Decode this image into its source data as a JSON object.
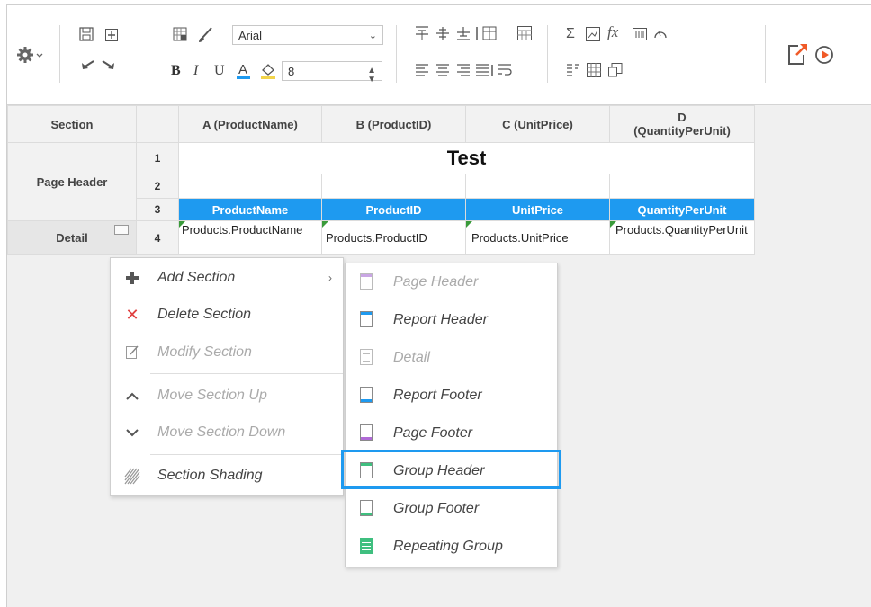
{
  "toolbar": {
    "font_name": "Arial",
    "font_size": "8",
    "bold": "B",
    "italic": "I",
    "underline": "U",
    "font_color": "A",
    "sigma": "Σ",
    "fx": "fx"
  },
  "grid": {
    "headers": [
      "Section",
      "",
      "A (ProductName)",
      "B (ProductID)",
      "C (UnitPrice)",
      "D\n(QuantityPerUnit)"
    ],
    "sections": {
      "page_header": "Page Header",
      "detail": "Detail"
    },
    "row_numbers": [
      "1",
      "2",
      "3",
      "4"
    ],
    "title": "Test",
    "column_headers": [
      "ProductName",
      "ProductID",
      "UnitPrice",
      "QuantityPerUnit"
    ],
    "detail_fields": [
      "Products.ProductName",
      "Products.ProductID",
      "Products.UnitPrice",
      "Products.QuantityPerUnit"
    ]
  },
  "context_menu": {
    "items": [
      {
        "label": "Add Section",
        "icon": "plus-icon",
        "enabled": true
      },
      {
        "label": "Delete Section",
        "icon": "close-icon",
        "enabled": true
      },
      {
        "label": "Modify Section",
        "icon": "edit-icon",
        "enabled": false
      },
      {
        "label": "Move Section Up",
        "icon": "chevron-up-icon",
        "enabled": false
      },
      {
        "label": "Move Section Down",
        "icon": "chevron-down-icon",
        "enabled": false
      },
      {
        "label": "Section Shading",
        "icon": "shading-icon",
        "enabled": true
      }
    ]
  },
  "submenu": {
    "items": [
      {
        "label": "Page Header",
        "enabled": false
      },
      {
        "label": "Report Header",
        "enabled": true
      },
      {
        "label": "Detail",
        "enabled": false
      },
      {
        "label": "Report Footer",
        "enabled": true
      },
      {
        "label": "Page Footer",
        "enabled": true
      },
      {
        "label": "Group Header",
        "enabled": true,
        "highlighted": true
      },
      {
        "label": "Group Footer",
        "enabled": true
      },
      {
        "label": "Repeating Group",
        "enabled": true
      }
    ]
  },
  "colors": {
    "accent": "#1e9af0",
    "header_blue": "#1e9af0",
    "green_marker": "#3a9b3a",
    "export_orange": "#f05a28"
  }
}
